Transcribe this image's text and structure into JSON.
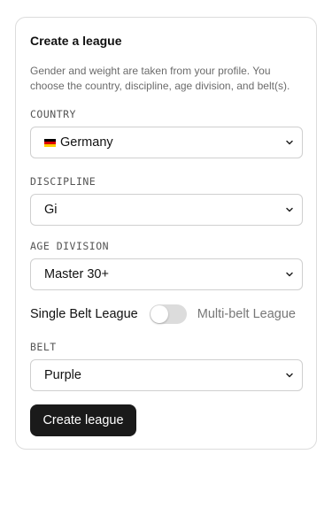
{
  "form": {
    "title": "Create a league",
    "description": "Gender and weight are taken from your profile. You choose the country, discipline, age division, and belt(s).",
    "country": {
      "label": "COUNTRY",
      "value": "Germany",
      "flag_icon": "germany-flag-icon"
    },
    "discipline": {
      "label": "DISCIPLINE",
      "value": "Gi"
    },
    "age_division": {
      "label": "AGE DIVISION",
      "value": "Master 30+"
    },
    "belt_mode": {
      "left_label": "Single Belt League",
      "right_label": "Multi-belt League",
      "multi_belt_enabled": false
    },
    "belt": {
      "label": "BELT",
      "value": "Purple"
    },
    "submit_label": "Create league"
  },
  "colors": {
    "button_bg": "#1a1a1a",
    "toggle_track": "#dcdcdc",
    "flag": [
      "#000000",
      "#dd0000",
      "#ffce00"
    ]
  }
}
